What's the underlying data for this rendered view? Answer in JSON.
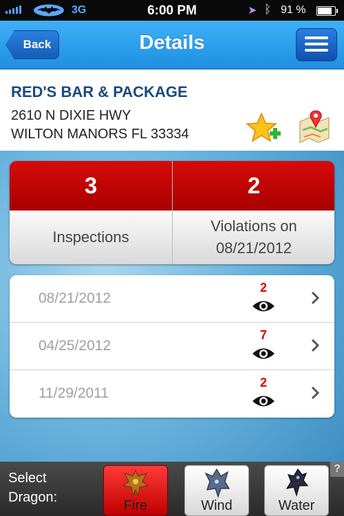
{
  "status_bar": {
    "carrier_icon": "batman-logo-icon",
    "network": "3G",
    "time": "6:00 PM",
    "battery": "91 %",
    "battery_level": 0.91
  },
  "nav": {
    "back_label": "Back",
    "title": "Details",
    "menu_icon": "menu-icon"
  },
  "establishment": {
    "name": "RED'S BAR & PACKAGE",
    "address_line1": "2610 N DIXIE HWY",
    "address_line2": "WILTON MANORS FL 33334"
  },
  "stats": {
    "inspections_count": "3",
    "inspections_label": "Inspections",
    "violations_count": "2",
    "violations_label_line1": "Violations on",
    "violations_label_line2": "08/21/2012"
  },
  "inspections": [
    {
      "date": "08/21/2012",
      "violations": "2"
    },
    {
      "date": "04/25/2012",
      "violations": "7"
    },
    {
      "date": "11/29/2011",
      "violations": "2"
    }
  ],
  "dragon_selector": {
    "label_line1": "Select",
    "label_line2": "Dragon:",
    "options": [
      {
        "name": "Fire",
        "selected": true
      },
      {
        "name": "Wind",
        "selected": false
      },
      {
        "name": "Water",
        "selected": false
      }
    ],
    "help": "?"
  },
  "colors": {
    "nav_blue": "#1e8fe2",
    "stat_red": "#c00000",
    "violation_red": "#dd0000",
    "name_blue": "#1a4a80"
  }
}
